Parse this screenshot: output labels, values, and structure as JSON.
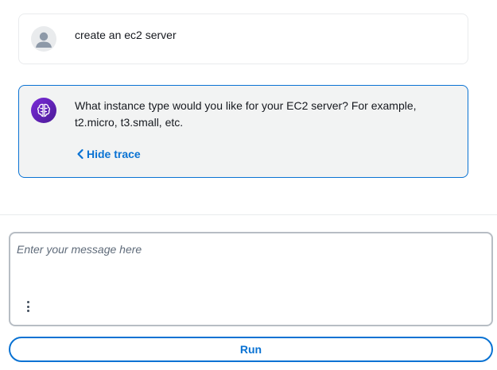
{
  "conversation": {
    "user_message": {
      "avatar_icon": "user-avatar-icon",
      "text": "create an ec2 server"
    },
    "agent_message": {
      "avatar_icon": "ai-brain-icon",
      "text": "What instance type would you like for your EC2 server? For example, t2.micro, t3.small, etc.",
      "trace_toggle_label": "Hide trace",
      "trace_toggle_icon": "chevron-left-icon"
    }
  },
  "composer": {
    "placeholder": "Enter your message here",
    "value": "",
    "options_icon": "more-vertical-icon",
    "run_label": "Run"
  },
  "colors": {
    "accent": "#0972d3",
    "agent_bubble_bg": "#f2f3f3",
    "agent_avatar": "#7a2bd9"
  }
}
